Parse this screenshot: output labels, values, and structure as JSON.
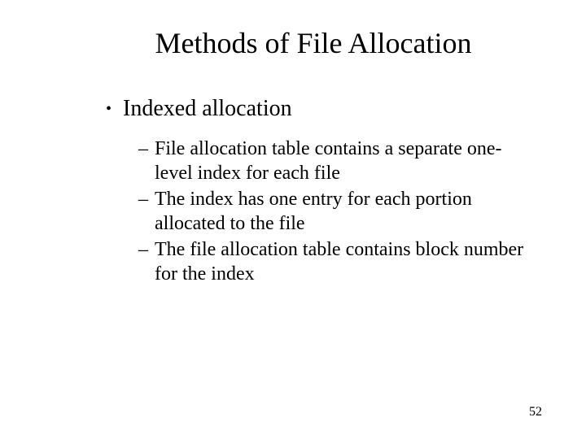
{
  "slide": {
    "title": "Methods of File Allocation",
    "bullet": {
      "marker": "•",
      "text": "Indexed allocation"
    },
    "sub_items": [
      {
        "marker": "–",
        "text": "File allocation table contains a separate one-level index for each file"
      },
      {
        "marker": "–",
        "text": "The index has one entry for each portion allocated to the file"
      },
      {
        "marker": "–",
        "text": "The file allocation table contains block number for the index"
      }
    ],
    "page_number": "52"
  }
}
